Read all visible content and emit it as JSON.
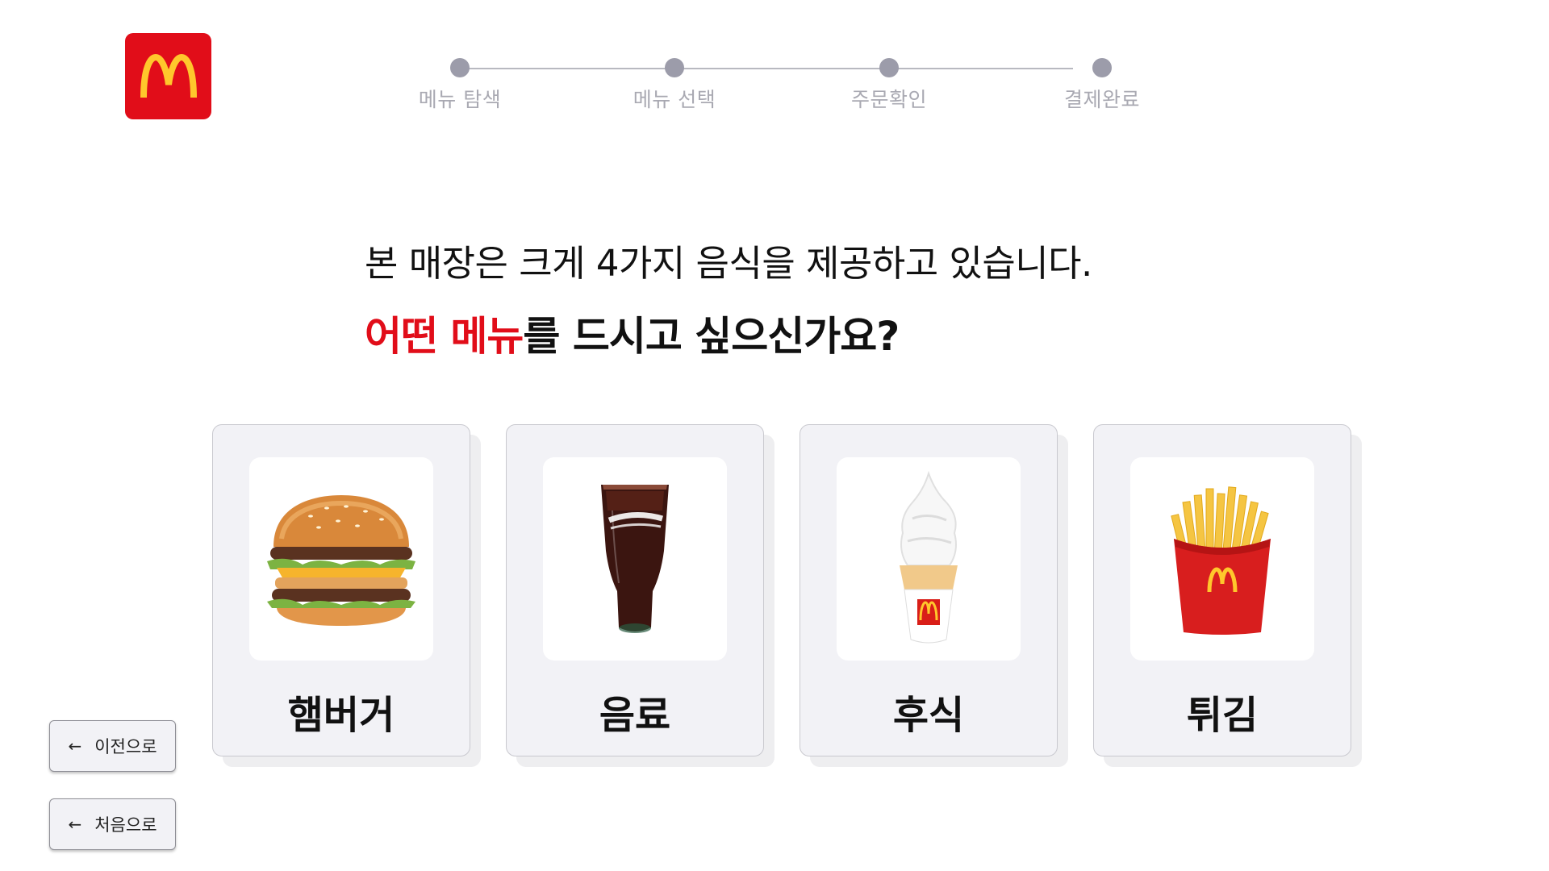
{
  "brand": {
    "logo_icon": "mcdonalds-golden-arches-icon",
    "color": "#e10d19",
    "arch_color": "#ffc72c"
  },
  "stepper": {
    "steps": [
      {
        "label": "메뉴 탐색"
      },
      {
        "label": "메뉴 선택"
      },
      {
        "label": "주문확인"
      },
      {
        "label": "결제완료"
      }
    ]
  },
  "question": {
    "line1": "본 매장은 크게 4가지 음식을 제공하고 있습니다.",
    "line2_accent": "어떤 메뉴",
    "line2_rest": "를 드시고 싶으신가요?"
  },
  "categories": [
    {
      "label": "햄버거",
      "icon": "hamburger-icon"
    },
    {
      "label": "음료",
      "icon": "cola-drink-icon"
    },
    {
      "label": "후식",
      "icon": "ice-cream-cone-icon"
    },
    {
      "label": "튀김",
      "icon": "french-fries-icon"
    }
  ],
  "nav": {
    "back_label": "이전으로",
    "home_label": "처음으로"
  }
}
